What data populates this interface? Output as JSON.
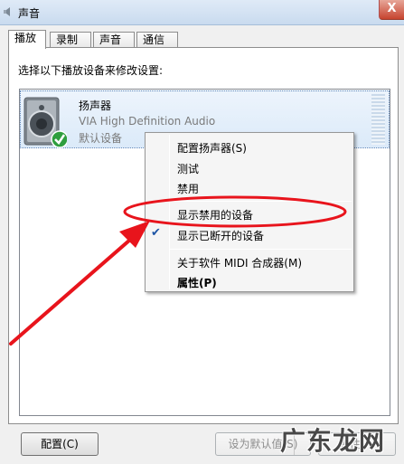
{
  "window": {
    "title": "声音",
    "close_label": "X"
  },
  "tabs": [
    {
      "label": "播放",
      "active": true
    },
    {
      "label": "录制",
      "active": false
    },
    {
      "label": "声音",
      "active": false
    },
    {
      "label": "通信",
      "active": false
    }
  ],
  "instruction": "选择以下播放设备来修改设置:",
  "device": {
    "name": "扬声器",
    "driver": "VIA High Definition Audio",
    "status": "默认设备",
    "icon": "speaker-icon",
    "status_icon": "green-check-icon"
  },
  "context_menu": {
    "items": [
      {
        "label": "配置扬声器(S)",
        "checked": false,
        "bold": false
      },
      {
        "label": "测试",
        "checked": false,
        "bold": false
      },
      {
        "label": "禁用",
        "checked": false,
        "bold": false
      },
      {
        "label": "显示禁用的设备",
        "checked": false,
        "bold": false
      },
      {
        "label": "显示已断开的设备",
        "checked": true,
        "bold": false
      },
      {
        "label": "关于软件 MIDI 合成器(M)",
        "checked": false,
        "bold": false
      },
      {
        "label": "属性(P)",
        "checked": false,
        "bold": true
      }
    ]
  },
  "annotation": {
    "color": "#e8141c",
    "highlight_target": "显示禁用的设备"
  },
  "buttons": {
    "configure": "配置(C)",
    "set_default": "设为默认值(S)",
    "properties": "属性(P)"
  },
  "watermark": "广东龙网"
}
